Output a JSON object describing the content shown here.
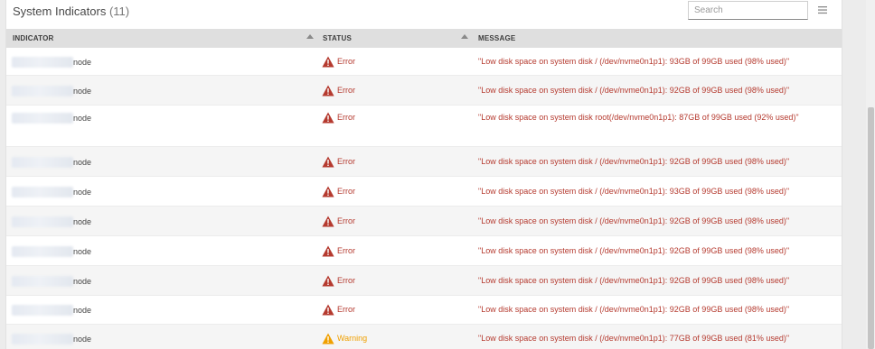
{
  "panel": {
    "title": "System Indicators",
    "count": "(11)",
    "search_placeholder": "Search",
    "menu_icon": "hamburger-menu-icon"
  },
  "columns": {
    "indicator": "INDICATOR",
    "status": "STATUS",
    "message": "MESSAGE"
  },
  "colors": {
    "error": "#b53a2f",
    "warning": "#f0a000",
    "header_bg": "#dfdfdf"
  },
  "rows": [
    {
      "node": "node",
      "status": "Error",
      "level": "error",
      "message": "\"Low disk space on system disk / (/dev/nvme0n1p1): 93GB of 99GB used (98% used)\""
    },
    {
      "node": "node",
      "status": "Error",
      "level": "error",
      "message": "\"Low disk space on system disk / (/dev/nvme0n1p1): 92GB of 99GB used (98% used)\""
    },
    {
      "node": "node",
      "status": "Error",
      "level": "error",
      "message": "\"Low disk space on system disk root(/dev/nvme0n1p1): 87GB of 99GB used (92% used)\""
    },
    {
      "node": "node",
      "status": "Error",
      "level": "error",
      "message": "\"Low disk space on system disk / (/dev/nvme0n1p1): 92GB of 99GB used (98% used)\""
    },
    {
      "node": "node",
      "status": "Error",
      "level": "error",
      "message": "\"Low disk space on system disk / (/dev/nvme0n1p1): 93GB of 99GB used (98% used)\""
    },
    {
      "node": "node",
      "status": "Error",
      "level": "error",
      "message": "\"Low disk space on system disk / (/dev/nvme0n1p1): 92GB of 99GB used (98% used)\""
    },
    {
      "node": "node",
      "status": "Error",
      "level": "error",
      "message": "\"Low disk space on system disk / (/dev/nvme0n1p1): 92GB of 99GB used (98% used)\""
    },
    {
      "node": "node",
      "status": "Error",
      "level": "error",
      "message": "\"Low disk space on system disk / (/dev/nvme0n1p1): 92GB of 99GB used (98% used)\""
    },
    {
      "node": "node",
      "status": "Error",
      "level": "error",
      "message": "\"Low disk space on system disk / (/dev/nvme0n1p1): 92GB of 99GB used (98% used)\""
    },
    {
      "node": "node",
      "status": "Warning",
      "level": "warning",
      "message": "\"Low disk space on system disk / (/dev/nvme0n1p1): 77GB of 99GB used (81% used)\""
    }
  ]
}
